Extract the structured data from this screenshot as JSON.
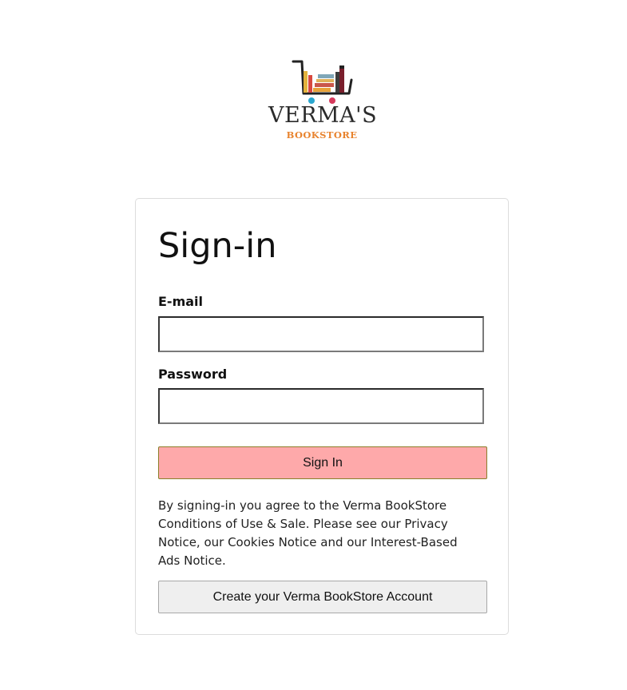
{
  "logo": {
    "name": "VERMA'S",
    "subtitle": "BOOKSTORE",
    "icon": "book-cart-icon",
    "colors": {
      "name": "#2b2b2b",
      "subtitle": "#e8832e",
      "wheel_left": "#2aa7cf",
      "wheel_right": "#d63a5c"
    }
  },
  "signin": {
    "title": "Sign-in",
    "email_label": "E-mail",
    "email_value": "",
    "password_label": "Password",
    "password_value": "",
    "submit_label": "Sign In",
    "terms_text": "By signing-in you agree to the Verma BookStore Conditions of Use & Sale. Please see our Privacy Notice, our Cookies Notice and our Interest-Based Ads Notice.",
    "create_account_label": "Create your Verma BookStore Account"
  },
  "colors": {
    "signin_button_bg": "#fea9aa",
    "create_button_bg": "#efefef",
    "card_border": "#dcdcdc"
  }
}
